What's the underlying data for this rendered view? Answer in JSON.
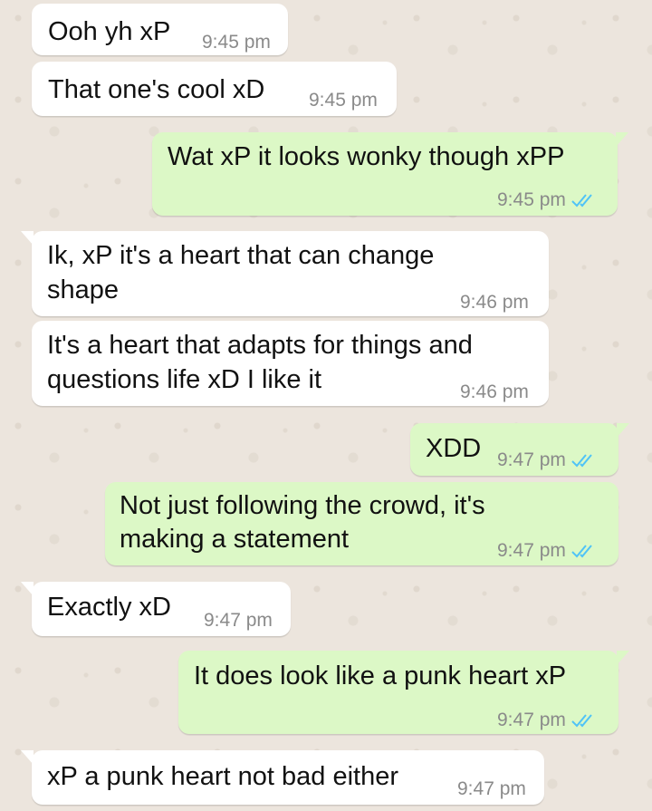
{
  "colors": {
    "incoming_bubble": "#ffffff",
    "outgoing_bubble": "#dcf8c6",
    "read_ticks": "#4fc3f7",
    "background": "#ece5dd"
  },
  "messages": [
    {
      "direction": "incoming",
      "lines": [
        "Ooh yh xP"
      ],
      "time": "9:45 pm"
    },
    {
      "direction": "incoming",
      "lines": [
        "That one's cool xD"
      ],
      "time": "9:45 pm"
    },
    {
      "direction": "outgoing",
      "lines": [
        "Wat xP it looks wonky though xPP"
      ],
      "time": "9:45 pm",
      "status": "read-double-tick-icon"
    },
    {
      "direction": "incoming",
      "lines": [
        "Ik, xP it's a heart that can change",
        "shape"
      ],
      "time": "9:46 pm"
    },
    {
      "direction": "incoming",
      "lines": [
        "It's a heart that adapts for things and",
        "questions life xD I like it"
      ],
      "time": "9:46 pm"
    },
    {
      "direction": "outgoing",
      "lines": [
        "XDD"
      ],
      "time": "9:47 pm",
      "status": "read-double-tick-icon"
    },
    {
      "direction": "outgoing",
      "lines": [
        "Not just following the crowd, it's",
        "making a statement"
      ],
      "time": "9:47 pm",
      "status": "read-double-tick-icon"
    },
    {
      "direction": "incoming",
      "lines": [
        "Exactly xD"
      ],
      "time": "9:47 pm"
    },
    {
      "direction": "outgoing",
      "lines": [
        "It does look like a punk heart xP"
      ],
      "time": "9:47 pm",
      "status": "read-double-tick-icon"
    },
    {
      "direction": "incoming",
      "lines": [
        "xP a punk heart not bad either"
      ],
      "time": "9:47 pm"
    }
  ]
}
